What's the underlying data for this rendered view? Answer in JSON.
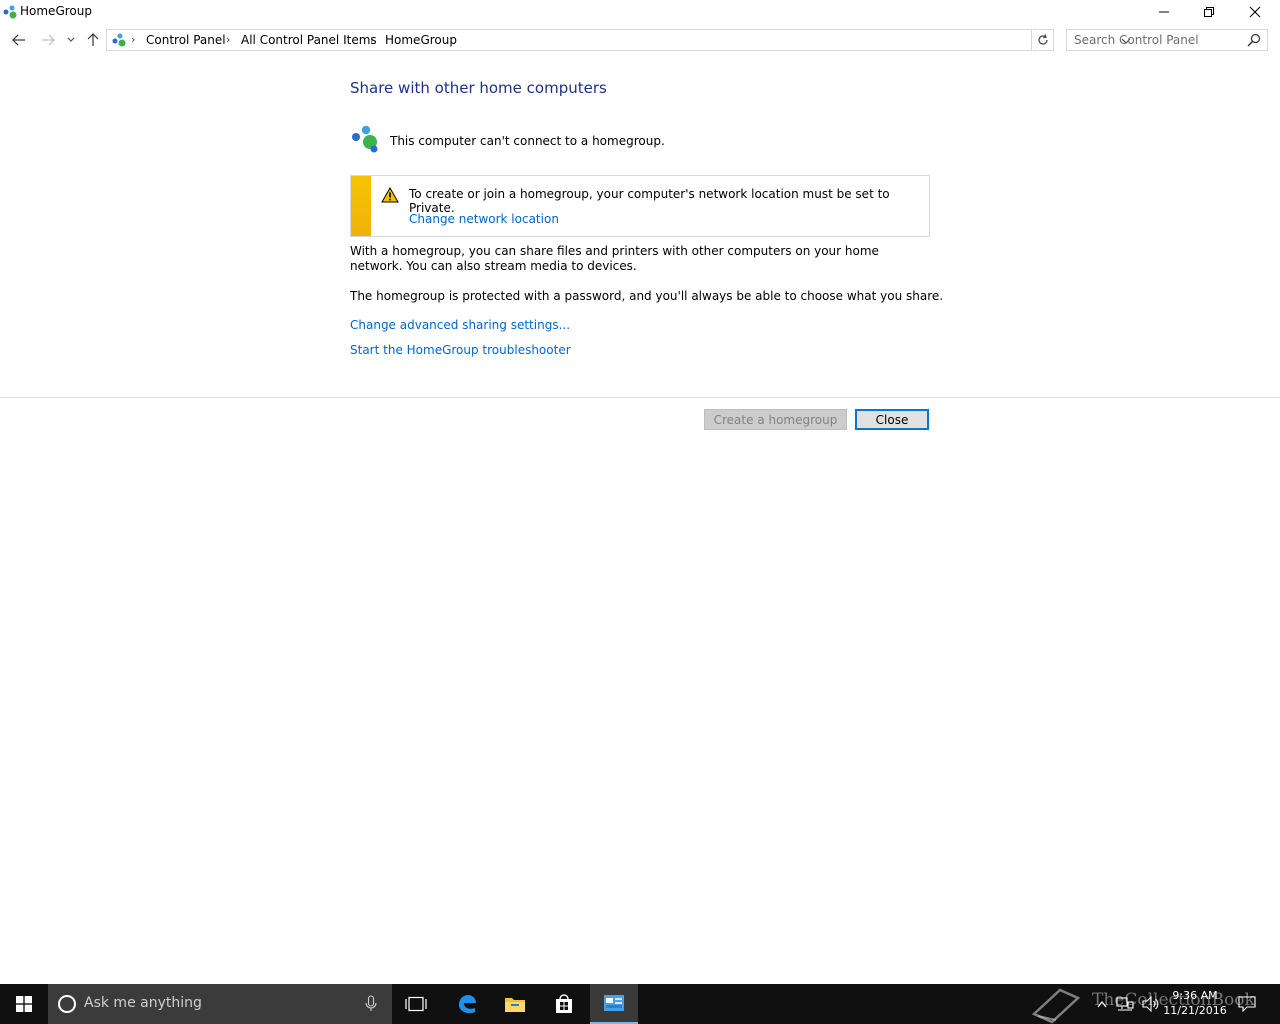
{
  "window": {
    "title": "HomeGroup"
  },
  "address": {
    "breadcrumbs": [
      "Control Panel",
      "All Control Panel Items",
      "HomeGroup"
    ]
  },
  "search": {
    "placeholder": "Search Control Panel"
  },
  "content": {
    "heading": "Share with other home computers",
    "status": "This computer can't connect to a homegroup.",
    "warning": {
      "text": "To create or join a homegroup, your computer's network location must be set to Private.",
      "link": "Change network location"
    },
    "description1": "With a homegroup, you can share files and printers with other computers on your home network. You can also stream media to devices.",
    "description2": "The homegroup is protected with a password, and you'll always be able to choose what you share.",
    "links": {
      "advanced_sharing": "Change advanced sharing settings...",
      "troubleshooter": "Start the HomeGroup troubleshooter"
    }
  },
  "buttons": {
    "create": "Create a homegroup",
    "close": "Close"
  },
  "taskbar": {
    "cortana_placeholder": "Ask me anything",
    "time": "9:36 AM",
    "date": "11/21/2016",
    "watermark": "TheCollectionBook"
  },
  "colors": {
    "heading": "#1e3287",
    "link": "#0066cc",
    "warning_stripe": "#f6c400",
    "focus_border": "#0078d7",
    "taskbar": "#101010"
  },
  "icons": {
    "app": "homegroup-icon",
    "warning": "warning-icon",
    "search": "search-icon",
    "refresh": "refresh-icon"
  }
}
